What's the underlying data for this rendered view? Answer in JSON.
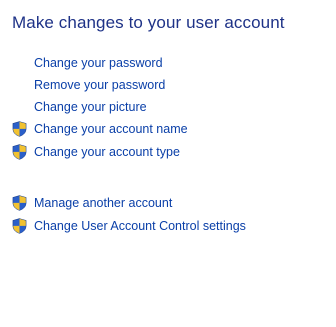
{
  "heading": "Make changes to your user account",
  "links": [
    {
      "label": "Change your password",
      "shield": false
    },
    {
      "label": "Remove your password",
      "shield": false
    },
    {
      "label": "Change your picture",
      "shield": false
    },
    {
      "label": "Change your account name",
      "shield": true,
      "icon": "uac-shield-icon"
    },
    {
      "label": "Change your account type",
      "shield": true,
      "icon": "uac-shield-icon"
    }
  ],
  "secondary_links": [
    {
      "label": "Manage another account",
      "shield": true,
      "icon": "uac-shield-icon"
    },
    {
      "label": "Change User Account Control settings",
      "shield": true,
      "icon": "uac-shield-icon"
    }
  ],
  "colors": {
    "heading": "#1e3287",
    "link": "#0a3fa8",
    "shield_blue": "#2a5fc9",
    "shield_yellow": "#f2c230"
  }
}
